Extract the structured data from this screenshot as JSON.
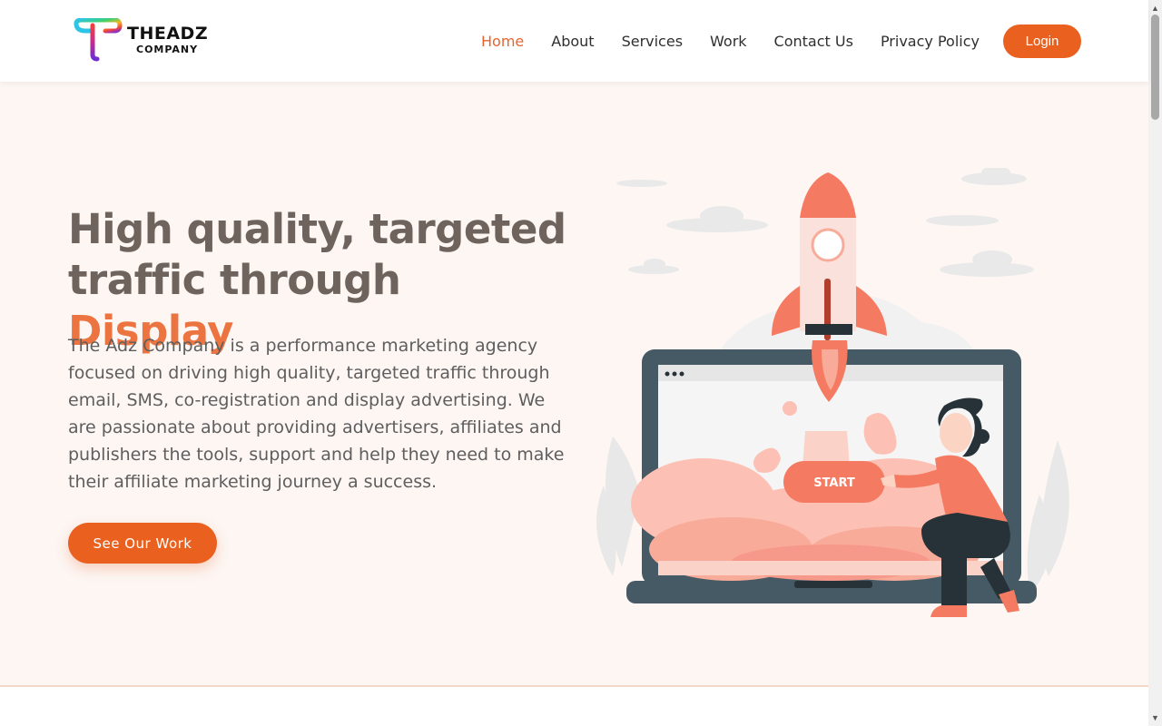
{
  "brand": {
    "name_line1": "THEADZ",
    "name_line2": "COMPANY"
  },
  "nav": {
    "items": [
      {
        "label": "Home",
        "active": true
      },
      {
        "label": "About"
      },
      {
        "label": "Services"
      },
      {
        "label": "Work"
      },
      {
        "label": "Contact Us"
      },
      {
        "label": "Privacy Policy"
      }
    ],
    "login_label": "Login"
  },
  "hero": {
    "title_part1": "High quality, targeted traffic through ",
    "title_accent": "Display",
    "description": "The Adz Company is a performance marketing agency focused on driving high quality, targeted traffic through email, SMS, co-registration and display advertising. We are passionate about providing advertisers, affiliates and publishers the tools, support and help they need to make their affiliate marketing journey a success.",
    "cta_label": "See Our Work"
  },
  "illustration": {
    "start_label": "START"
  },
  "colors": {
    "accent": "#e9601f",
    "accent_text": "#ec7440",
    "title": "#6f635d",
    "hero_bg": "#fdf6f3"
  }
}
